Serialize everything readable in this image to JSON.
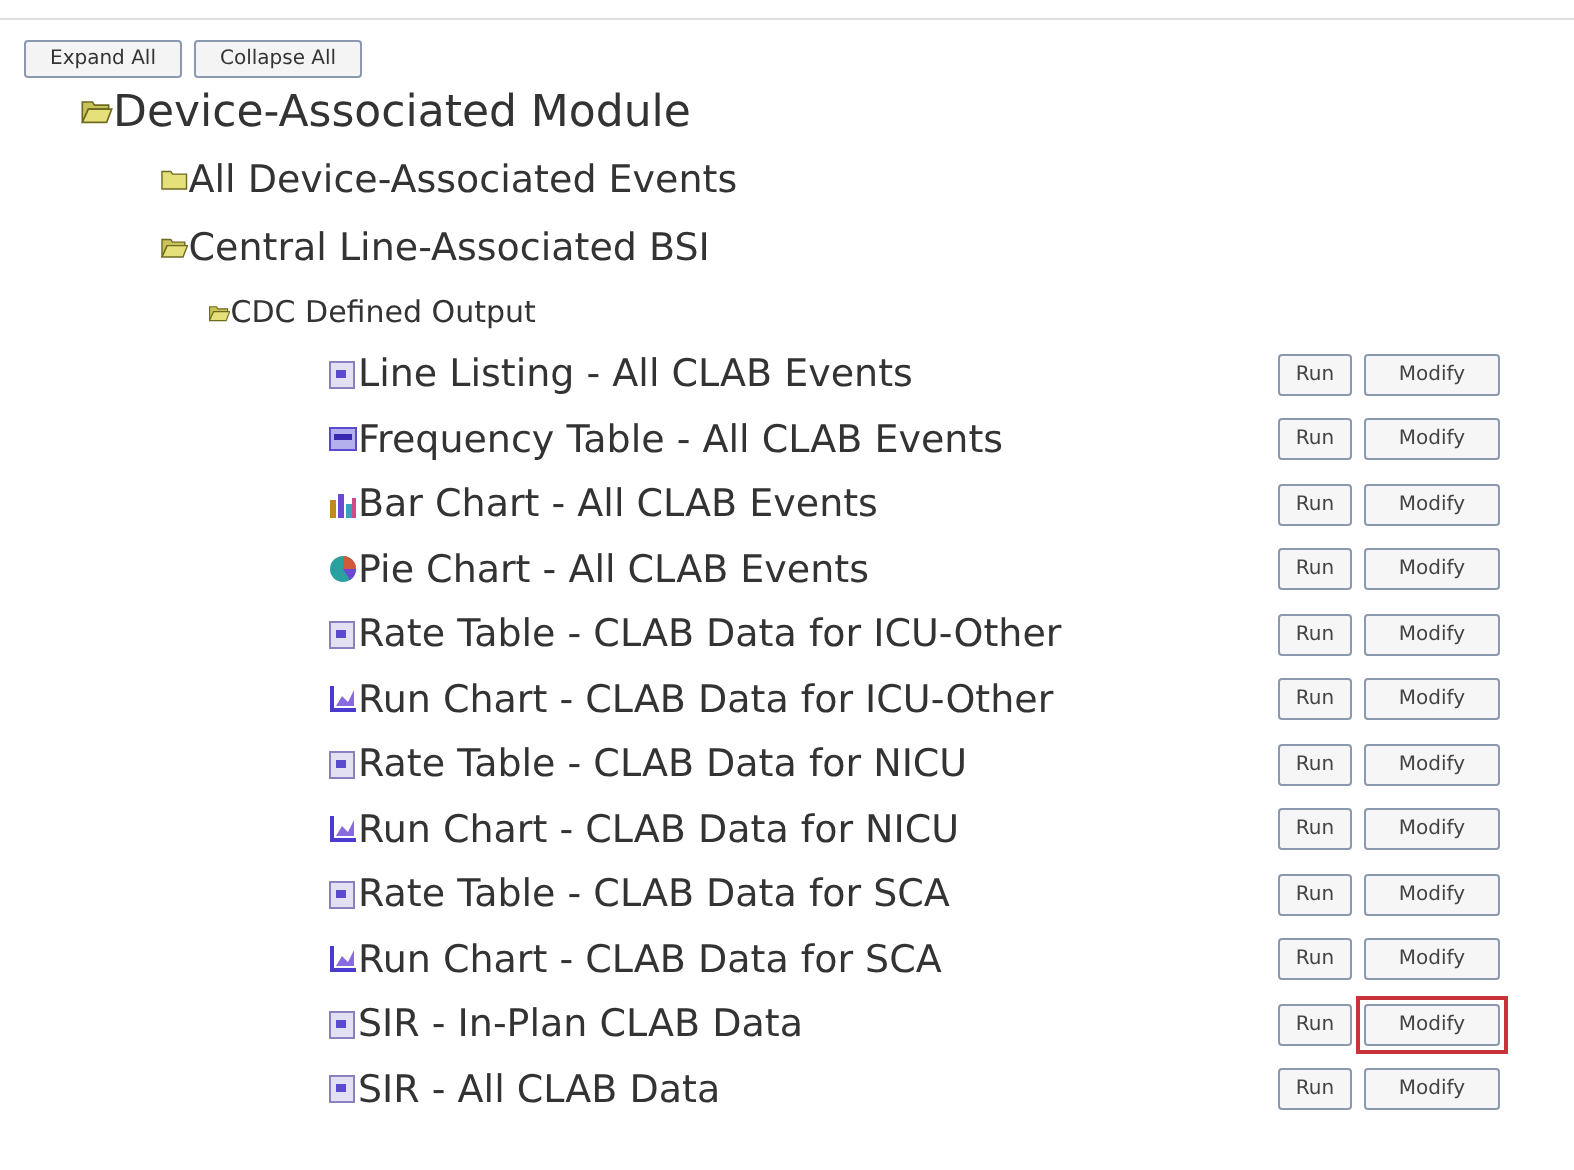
{
  "toolbar": [
    "Expand All",
    "Collapse All"
  ],
  "tree": [
    {
      "label": "Device-Associated Module",
      "expanded": true,
      "children": [
        {
          "label": "All Device-Associated Events",
          "expanded": false
        },
        {
          "label": "Central Line-Associated BSI",
          "expanded": true,
          "children": [
            {
              "label": "CDC Defined Output",
              "expanded": true,
              "reports": [
                {
                  "kind": "listing",
                  "label": "Line Listing - All CLAB Events",
                  "run": "Run",
                  "modify": "Modify",
                  "highlighted": false
                },
                {
                  "kind": "table",
                  "label": "Frequency Table - All CLAB Events",
                  "run": "Run",
                  "modify": "Modify",
                  "highlighted": false
                },
                {
                  "kind": "bar",
                  "label": "Bar Chart - All CLAB Events",
                  "run": "Run",
                  "modify": "Modify",
                  "highlighted": false
                },
                {
                  "kind": "pie",
                  "label": "Pie Chart - All CLAB Events",
                  "run": "Run",
                  "modify": "Modify",
                  "highlighted": false
                },
                {
                  "kind": "listing",
                  "label": "Rate Table - CLAB Data for ICU-Other",
                  "run": "Run",
                  "modify": "Modify",
                  "highlighted": false
                },
                {
                  "kind": "run",
                  "label": "Run Chart - CLAB Data for ICU-Other",
                  "run": "Run",
                  "modify": "Modify",
                  "highlighted": false
                },
                {
                  "kind": "listing",
                  "label": "Rate Table - CLAB Data for NICU",
                  "run": "Run",
                  "modify": "Modify",
                  "highlighted": false
                },
                {
                  "kind": "run",
                  "label": "Run Chart - CLAB Data for NICU",
                  "run": "Run",
                  "modify": "Modify",
                  "highlighted": false
                },
                {
                  "kind": "listing",
                  "label": "Rate Table - CLAB Data for SCA",
                  "run": "Run",
                  "modify": "Modify",
                  "highlighted": false
                },
                {
                  "kind": "run",
                  "label": "Run Chart - CLAB Data for SCA",
                  "run": "Run",
                  "modify": "Modify",
                  "highlighted": false
                },
                {
                  "kind": "listing",
                  "label": "SIR - In-Plan CLAB Data",
                  "run": "Run",
                  "modify": "Modify",
                  "highlighted": true
                },
                {
                  "kind": "listing",
                  "label": "SIR - All CLAB Data",
                  "run": "Run",
                  "modify": "Modify",
                  "highlighted": false
                }
              ]
            }
          ]
        }
      ]
    }
  ]
}
